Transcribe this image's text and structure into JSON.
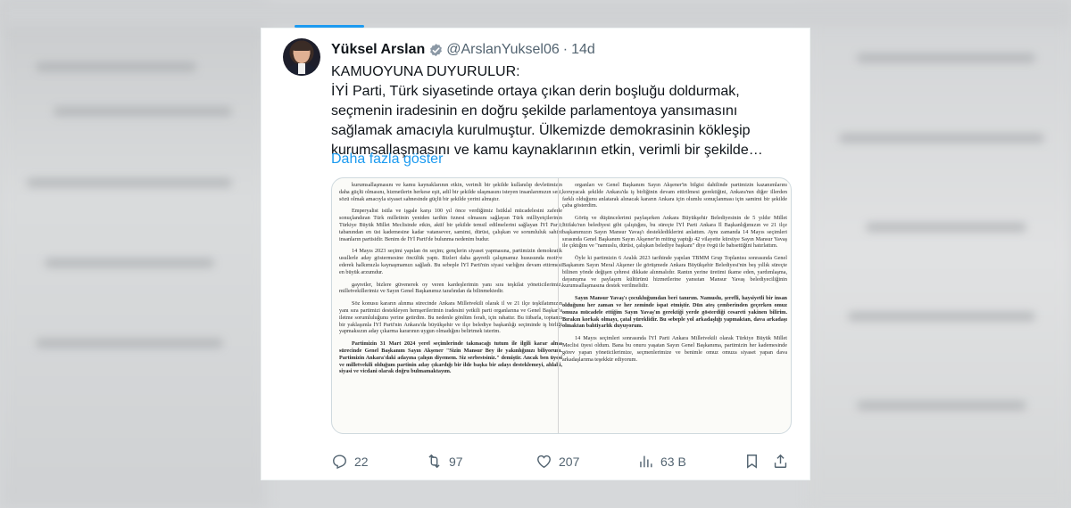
{
  "tweet": {
    "author_name": "Yüksel Arslan",
    "handle": "@ArslanYuksel06",
    "separator": "·",
    "time": "14d",
    "heading": "KAMUOYUNA DUYURULUR:",
    "text": "İYİ Parti, Türk siyasetinde ortaya çıkan derin boşluğu doldurmak, seçmenin iradesinin en doğru şekilde parlamentoya yansımasını sağlamak amacıyla kurulmuştur. Ülkemizde demokrasinin kökleşip kurumsallaşmasını ve kamu kaynaklarının etkin, verimli bir şekilde…",
    "show_more": "Daha fazla göster"
  },
  "document": {
    "left": [
      {
        "text": "kurumsallaşmasını ve kamu kaynaklarının etkin, verimli bir şekilde kullanılıp devletimizin daha güçlü olmasını, hizmetlerin herkese eşit, adil bir şekilde ulaşmasını isteyen insanlarımızın sesi, sözü olmak amacıyla siyaset sahnesinde güçlü bir şekilde yerini almıştır.",
        "bold": false
      },
      {
        "text": "Emperyalist istila ve işgale karşı 100 yıl önce verdiğimiz İstiklal mücadelesini zaferle sonuçlandıran Türk milletinin yeniden tarihin öznesi olmasını sağlayan Türk milliyetçilerinin Türkiye Büyük Millet Meclisinde etkin, aktif bir şekilde temsil edilmelerini sağlayan İYİ Parti; tabanından en üst kademesine kadar vatansever, samimi, dürüst, çalışkan ve sorumluluk sahibi insanların partisidir. Benim de İYİ Parti'de bulunma nedenim budur.",
        "bold": false
      },
      {
        "text": "14 Mayıs 2023 seçimi yapılan ön seçim; gençlerin siyaset yapmasına, partimizin demokratik usullerle aday göstermesine öncülük yaptı. Bizleri daha gayretli çalışmamız hususunda motive ederek halkımızla kaynaşmamızı sağladı. Bu sebeple İYİ Parti'nin siyasi varlığını devam ettirmesi en büyük arzumdur.",
        "bold": false
      },
      {
        "text": "gayretler, bizlere güvenerek oy veren kardeşlerimin yanı sıra teşkilat yöneticilerimiz, milletvekillerimiz ve Sayın Genel Başkanımız tarafından da bilinmektedir.",
        "bold": false
      },
      {
        "text": "Söz konusu kararın alınma sürecinde Ankara Milletvekili olarak il ve 21 ilçe teşkilatımızın yanı sıra partimizi destekleyen hemşerilerimin iradesini yetkili parti organlarına ve Genel Başkan'a iletme sorumluluğunu yerine getirdim. Bu nedenle gönlüm ferah, için rahattır. Bu itibarla, toptancı bir yaklaşımla İYİ Parti'nin Ankara'da büyükşehir ve ilçe belediye başkanlığı seçiminde iş birliği yapmaksızın aday çıkarma kararının uygun olmadığını belirtmek isterim.",
        "bold": false
      },
      {
        "text": "Partimizin 31 Mart 2024 yerel seçimlerinde takınacağı tutum ile ilgili karar alma sürecinde Genel Başkanım Sayın Akşener \"Sizin Mansur Bey ile yakınlığınızı biliyorum. Partimizin Ankara'daki adayına çalışın diyemem. Siz serbestsiniz.\" demiştir. Ancak ben üyesi ve milletvekili olduğum partinin aday çıkardığı bir ilde başka bir adayı desteklemeyi, ahlaki, siyasi ve vicdani olarak doğru bulmamaktayım.",
        "bold": true
      }
    ],
    "right": [
      {
        "text": "organları ve Genel Başkanım Sayın Akşener'in bilgisi dahilinde partimizin kazanımlarını koruyacak şekilde Ankara'da iş birliğinin devam ettirilmesi gerektiğini, Ankara'nın diğer illerden farklı olduğunu anlatarak alınacak kararın Ankara için olumlu sonuçlanması için samimi bir şekilde çaba gösterdim.",
        "bold": false
      },
      {
        "text": "Görüş ve düşüncelerimi paylaşırken Ankara Büyükşehir Belediyesinin de 5 yıldır Millet İttifakı'nın belediyesi gibi çalıştığını, bu süreçte İYİ Parti Ankara İl Başkanlığımızın ve 21 ilçe başkanımızın Sayın Mansur Yavaş'ı desteklediklerini anlattım. Aynı zamanda 14 Mayıs seçimleri sırasında Genel Başkanım Sayın Akşener'in miting yaptığı 42 vilayette kürsüye Sayın Mansur Yavaş ile çıktığını ve \"namuslu, dürüst, çalışkan belediye başkanı\" diye övgü ile bahsettiğini hatırlattım.",
        "bold": false
      },
      {
        "text": "Öyle ki partimizin 6 Aralık 2023 tarihinde yapılan TBMM Grup Toplantısı sonrasında Genel Başkanım Sayın Meral Akşener ile görüşmede Ankara Büyükşehir Belediyesi'nin beş yıllık süreçte bilinen yönde değişen çehresi dikkate alınmalıdır. Rantın yerine üretimi ikame eden, yardımlaşma, dayanışma ve paylaşım kültürünü hizmetlerine yansıtan Mansur Yavaş belediyeciliğinin kurumsallaşmasına destek verilmelidir.",
        "bold": false
      },
      {
        "text": "Sayın Mansur Yavaş'ı çocukluğumdan beri tanırım. Namuslu, şerefli, haysiyetli bir insan olduğunu her zaman ve her zeminde ispat etmiştir. Dün ateş çemberinden geçerken omuz omuza mücadele ettiğim Sayın Yavaş'ın gerektiği yerde gösterdiği cesareti yakinen bilirim. Bırakın korkak olmayı, çatal yüreklidir. Bu sebeple yol arkadaşlığı yapmaktan, dava arkadaşı olmaktan bahtiyarlık duyuyorum.",
        "bold": true
      },
      {
        "text": "14 Mayıs seçimleri sonrasında İYİ Parti Ankara Milletvekili olarak Türkiye Büyük Millet Meclisi üyesi oldum. Bana bu onuru yaşatan Sayın Genel Başkanıma, partimizin her kademesinde görev yapan yöneticilerimize, seçmenlerimize ve benimle omuz omuza siyaset yapan dava arkadaşlarıma teşekkür ediyorum.",
        "bold": false
      }
    ]
  },
  "actions": {
    "replies": "22",
    "reposts": "97",
    "likes": "207",
    "views": "63 B"
  },
  "colors": {
    "accent": "#1d9bf0",
    "text": "#0f1419",
    "muted": "#536471"
  },
  "icons": [
    "verified-badge-icon",
    "reply-icon",
    "repost-icon",
    "like-icon",
    "views-icon",
    "bookmark-icon",
    "share-icon"
  ]
}
